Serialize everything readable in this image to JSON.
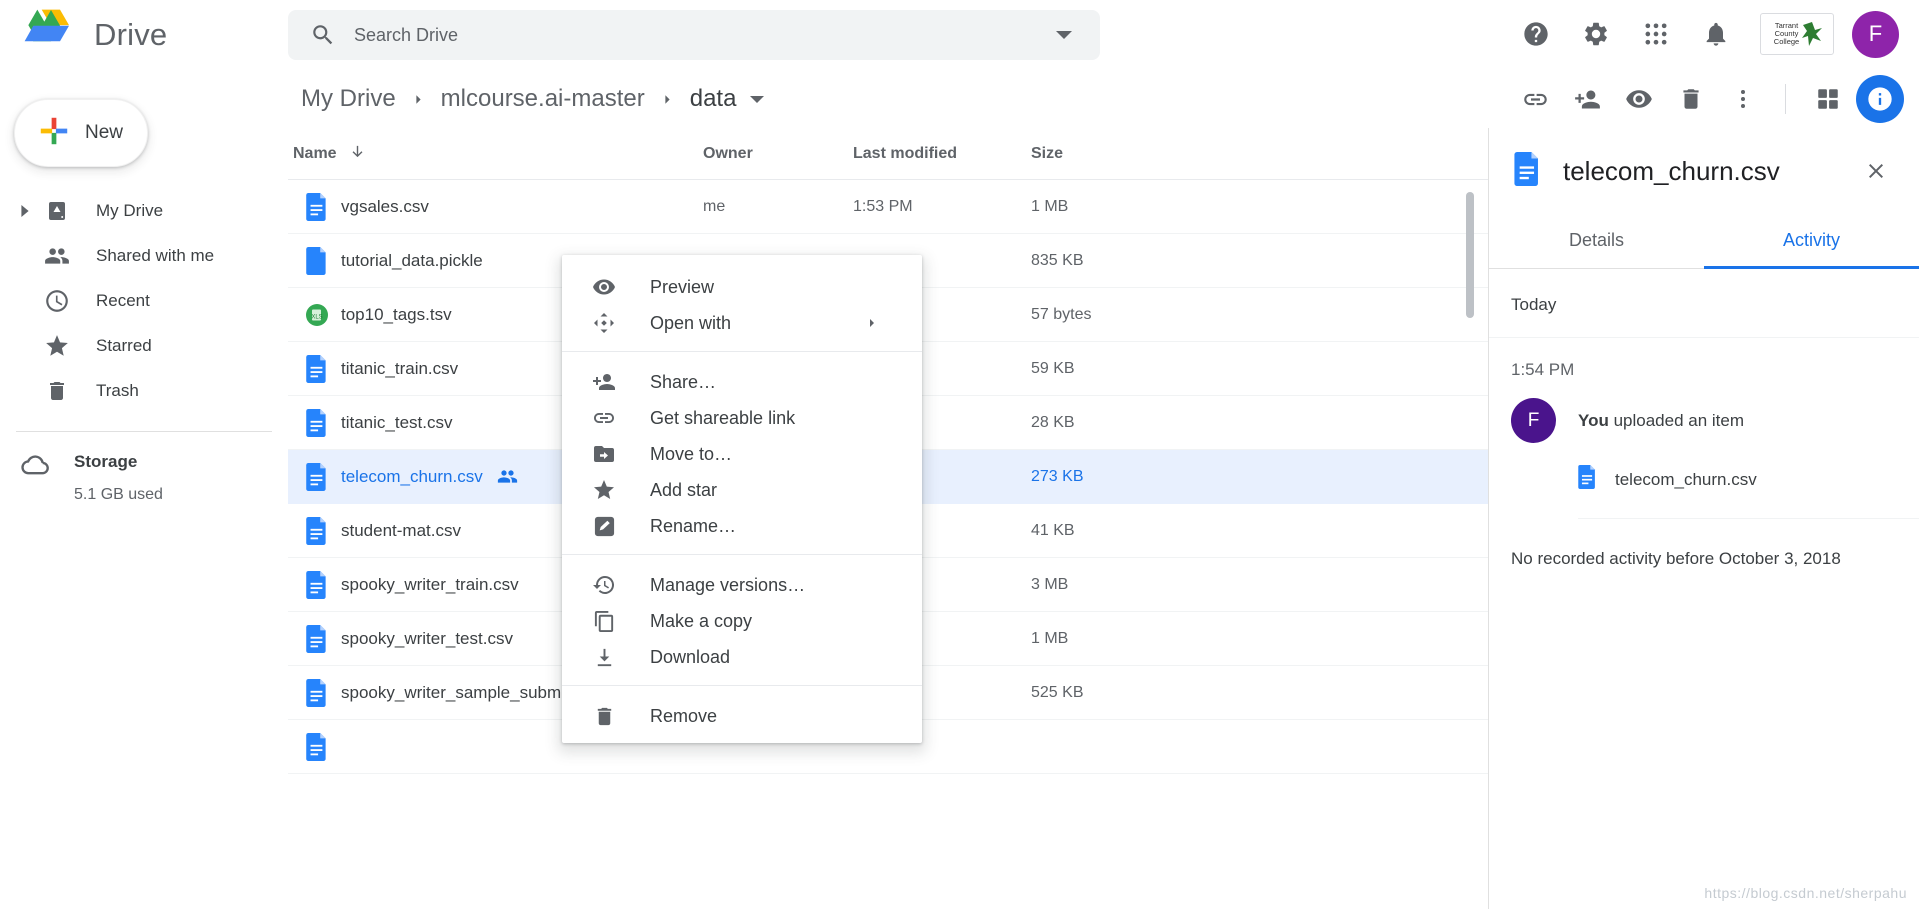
{
  "app": {
    "brand": "Drive",
    "logo_icon": "drive-logo-icon"
  },
  "search": {
    "placeholder": "Search Drive",
    "value": "",
    "icon": "search-icon",
    "dropdown_icon": "chevron-down-icon"
  },
  "top_icons": [
    {
      "name": "help-icon",
      "label": "Help"
    },
    {
      "name": "settings-gear-icon",
      "label": "Settings"
    },
    {
      "name": "apps-grid-icon",
      "label": "Google apps"
    },
    {
      "name": "notifications-bell-icon",
      "label": "Notifications"
    }
  ],
  "org_logo": {
    "line1": "Tarrant",
    "line2": "County",
    "line3": "College"
  },
  "account": {
    "initial": "F",
    "color": "#8e24aa"
  },
  "sidebar": {
    "new_button": {
      "label": "New",
      "icon": "plus-icon"
    },
    "items": [
      {
        "label": "My Drive",
        "icon": "my-drive-icon",
        "expandable": true
      },
      {
        "label": "Shared with me",
        "icon": "people-icon",
        "expandable": false
      },
      {
        "label": "Recent",
        "icon": "clock-icon",
        "expandable": false
      },
      {
        "label": "Starred",
        "icon": "star-icon",
        "expandable": false
      },
      {
        "label": "Trash",
        "icon": "trash-icon",
        "expandable": false
      }
    ],
    "storage": {
      "title": "Storage",
      "used": "5.1 GB used",
      "icon": "cloud-icon"
    }
  },
  "breadcrumb": {
    "items": [
      "My Drive",
      "mlcourse.ai-master",
      "data"
    ],
    "separator_icon": "chevron-right-icon",
    "dropdown_icon": "caret-down-icon"
  },
  "action_bar": [
    {
      "name": "link-icon",
      "label": "Get shareable link"
    },
    {
      "name": "add-person-icon",
      "label": "Share"
    },
    {
      "name": "eye-icon",
      "label": "Preview"
    },
    {
      "name": "trash-icon",
      "label": "Remove"
    },
    {
      "name": "more-vert-icon",
      "label": "More actions"
    },
    {
      "name": "grid-view-icon",
      "label": "Grid view"
    },
    {
      "name": "info-icon",
      "label": "View details",
      "active": true
    }
  ],
  "table": {
    "columns": [
      "Name",
      "Owner",
      "Last modified",
      "Size"
    ],
    "sort_icon": "arrow-down-icon",
    "rows": [
      {
        "name": "vgsales.csv",
        "icon": "csv-file-icon",
        "owner": "me",
        "modified": "1:53 PM",
        "size": "1 MB",
        "selected": false,
        "shared": false
      },
      {
        "name": "tutorial_data.pickle",
        "icon": "generic-file-icon",
        "owner": "",
        "modified": "",
        "size": "835 KB",
        "selected": false,
        "shared": false
      },
      {
        "name": "top10_tags.tsv",
        "icon": "sheet-file-icon",
        "owner": "",
        "modified": "",
        "size": "57 bytes",
        "selected": false,
        "shared": false
      },
      {
        "name": "titanic_train.csv",
        "icon": "csv-file-icon",
        "owner": "",
        "modified": "",
        "size": "59 KB",
        "selected": false,
        "shared": false
      },
      {
        "name": "titanic_test.csv",
        "icon": "csv-file-icon",
        "owner": "",
        "modified": "",
        "size": "28 KB",
        "selected": false,
        "shared": false
      },
      {
        "name": "telecom_churn.csv",
        "icon": "csv-file-icon",
        "owner": "",
        "modified": "",
        "size": "273 KB",
        "selected": true,
        "shared": true
      },
      {
        "name": "student-mat.csv",
        "icon": "csv-file-icon",
        "owner": "",
        "modified": "",
        "size": "41 KB",
        "selected": false,
        "shared": false
      },
      {
        "name": "spooky_writer_train.csv",
        "icon": "csv-file-icon",
        "owner": "",
        "modified": "",
        "size": "3 MB",
        "selected": false,
        "shared": false
      },
      {
        "name": "spooky_writer_test.csv",
        "icon": "csv-file-icon",
        "owner": "",
        "modified": "",
        "size": "1 MB",
        "selected": false,
        "shared": false
      },
      {
        "name": "spooky_writer_sample_submiss",
        "icon": "csv-file-icon",
        "owner": "",
        "modified": "",
        "size": "525 KB",
        "selected": false,
        "shared": false
      },
      {
        "name": "",
        "icon": "csv-file-icon",
        "owner": "",
        "modified": "",
        "size": "",
        "selected": false,
        "shared": false
      }
    ]
  },
  "context_menu": {
    "groups": [
      [
        {
          "label": "Preview",
          "icon": "eye-icon",
          "submenu": false
        },
        {
          "label": "Open with",
          "icon": "open-with-icon",
          "submenu": true
        }
      ],
      [
        {
          "label": "Share…",
          "icon": "add-person-icon",
          "submenu": false
        },
        {
          "label": "Get shareable link",
          "icon": "link-icon",
          "submenu": false
        },
        {
          "label": "Move to…",
          "icon": "move-folder-icon",
          "submenu": false
        },
        {
          "label": "Add star",
          "icon": "star-icon",
          "submenu": false
        },
        {
          "label": "Rename…",
          "icon": "rename-pencil-icon",
          "submenu": false
        }
      ],
      [
        {
          "label": "Manage versions…",
          "icon": "history-icon",
          "submenu": false
        },
        {
          "label": "Make a copy",
          "icon": "copy-icon",
          "submenu": false
        },
        {
          "label": "Download",
          "icon": "download-icon",
          "submenu": false
        }
      ],
      [
        {
          "label": "Remove",
          "icon": "trash-icon",
          "submenu": false
        }
      ]
    ]
  },
  "detail_panel": {
    "file_name": "telecom_churn.csv",
    "file_icon": "csv-file-icon",
    "close_icon": "close-icon",
    "tabs": [
      {
        "label": "Details",
        "active": false
      },
      {
        "label": "Activity",
        "active": true
      }
    ],
    "section_today": "Today",
    "activity": {
      "time": "1:54 PM",
      "actor": "You",
      "action": " uploaded an item",
      "avatar_initial": "F",
      "avatar_color": "#4a148c",
      "item_name": "telecom_churn.csv",
      "item_icon": "csv-file-icon"
    },
    "no_activity": "No recorded activity before October 3, 2018"
  },
  "watermark": "https://blog.csdn.net/sherpahu"
}
